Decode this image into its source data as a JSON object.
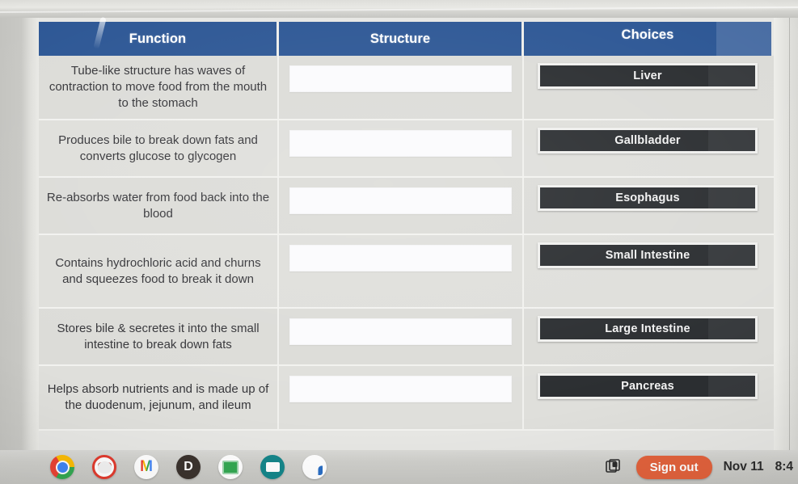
{
  "table": {
    "headers": {
      "function": "Function",
      "structure": "Structure",
      "choices": "Choices"
    },
    "rows": [
      {
        "function": "Tube-like structure has waves of contraction to move food from the mouth to the stomach",
        "structure_value": "",
        "choice": "Liver"
      },
      {
        "function": "Produces bile to break down fats and converts glucose to glycogen",
        "structure_value": "",
        "choice": "Gallbladder"
      },
      {
        "function": "Re-absorbs water from food back into the blood",
        "structure_value": "",
        "choice": "Esophagus"
      },
      {
        "function": "Contains hydrochloric acid and churns and squeezes food to break it down",
        "structure_value": "",
        "choice": "Small Intestine"
      },
      {
        "function": "Stores bile & secretes it into the small intestine to break down fats",
        "structure_value": "",
        "choice": "Large Intestine"
      },
      {
        "function": "Helps absorb nutrients and is made up of the duodenum, jejunum, and ileum",
        "structure_value": "",
        "choice": "Pancreas"
      }
    ]
  },
  "shelf": {
    "apps": [
      {
        "name": "chrome-icon",
        "label": ""
      },
      {
        "name": "paint-icon",
        "label": ""
      },
      {
        "name": "gmail-icon",
        "label": "M"
      },
      {
        "name": "d-app-icon",
        "label": "D"
      },
      {
        "name": "google-classroom-icon",
        "label": ""
      },
      {
        "name": "teal-app-icon",
        "label": ""
      },
      {
        "name": "clever-icon",
        "label": ""
      }
    ],
    "tray": {
      "screen_capture_icon": "screen-capture-icon",
      "sign_out_label": "Sign out",
      "date": "Nov 11",
      "time": "8:4"
    }
  },
  "colors": {
    "header_blue": "#2d5795",
    "chip_dark": "#2b2e31",
    "signout_orange": "#e2623c",
    "row_gray": "#dcdcd8",
    "dropzone_white": "#fbfbfd"
  }
}
